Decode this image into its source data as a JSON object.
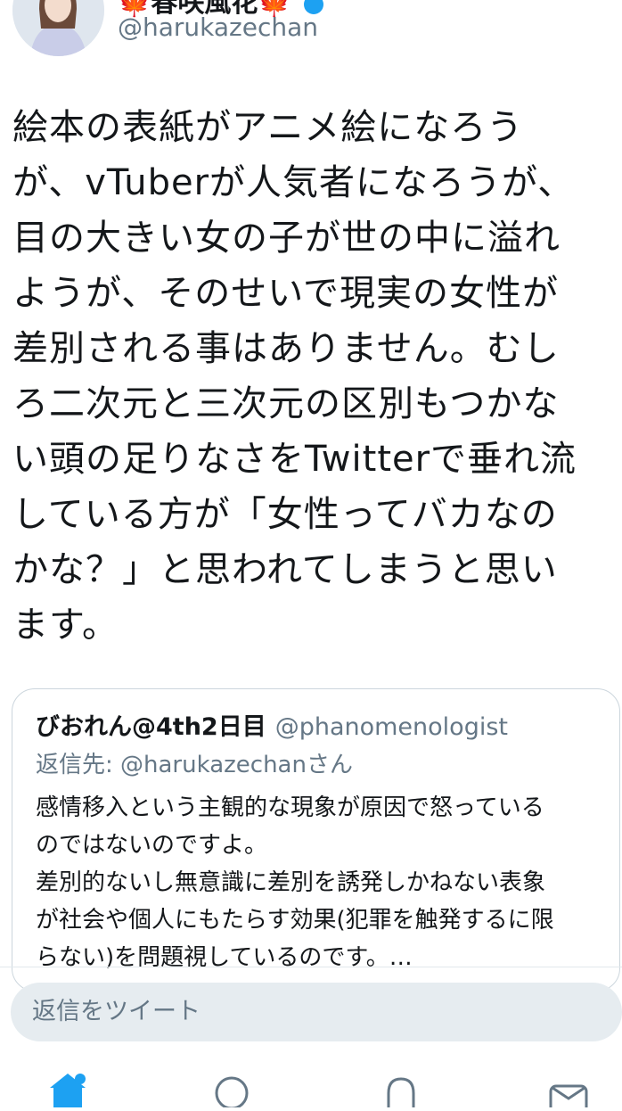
{
  "tweet": {
    "author_name": "春咲風花",
    "handle": "@harukazechan",
    "text": "絵本の表紙がアニメ絵になろう\nが、vTuberが人気者になろうが、\n目の大きい女の子が世の中に溢れ\nようが、そのせいで現実の女性が\n差別される事はありません。むし\nろ二次元と三次元の区別もつかな\nい頭の足りなさをTwitterで垂れ流\nしている方が「女性ってバカなの\nかな？」と思われてしまうと思い\nます。"
  },
  "quoted_tweet": {
    "author_name": "びおれん@4th2日目",
    "handle": "@phanomenologist",
    "reply_to": "返信先: @harukazechanさん",
    "text": "感情移入という主観的な現象が原因で怒っている\nのではないのですよ。\n差別的ないし無意識に差別を誘発しかねない表象\nが社会や個人にもたらす効果(犯罪を触発するに限\nらない)を問題視しているのです。…"
  },
  "reply_input": {
    "placeholder": "返信をツイート"
  },
  "tabbar": {
    "tabs": [
      {
        "name": "home",
        "icon": "home-icon",
        "active": true
      },
      {
        "name": "search",
        "icon": "search-icon",
        "active": false
      },
      {
        "name": "notifications",
        "icon": "bell-icon",
        "active": false
      },
      {
        "name": "messages",
        "icon": "mail-icon",
        "active": false
      }
    ]
  },
  "colors": {
    "accent": "#1da1f2",
    "text": "#14171a",
    "secondary": "#657786",
    "reply_bg": "#e6ecf0"
  }
}
